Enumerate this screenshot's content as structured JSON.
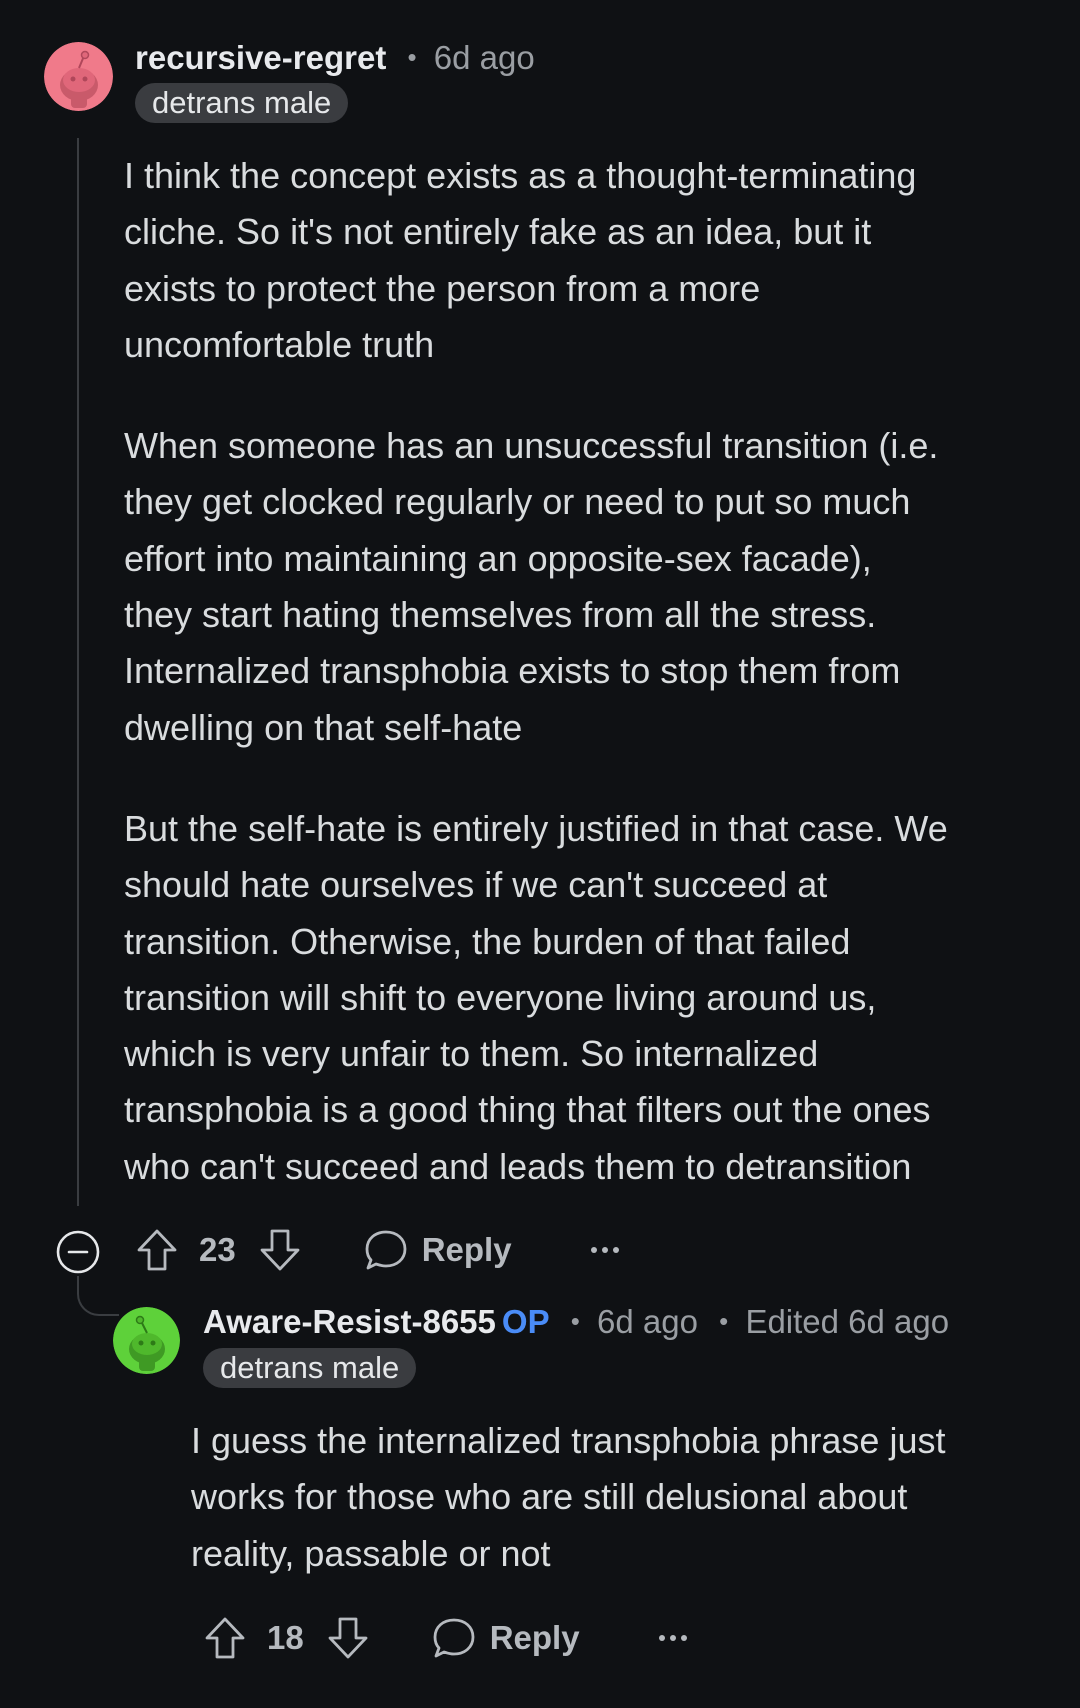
{
  "comments": [
    {
      "username": "recursive-regret",
      "separator": "•",
      "timestamp": "6d ago",
      "flair": "detrans male",
      "paragraphs": [
        [
          "I think the concept exists as a thought-terminating",
          "cliche. So it's not entirely fake as an idea, but it",
          "exists to protect the person from a more",
          "uncomfortable truth"
        ],
        [
          "When someone has an unsuccessful transition (i.e.",
          "they get clocked regularly or need to put so much",
          "effort into maintaining an opposite-sex facade),",
          "they start hating themselves from all the stress.",
          "Internalized transphobia exists to stop them from",
          "dwelling on that self-hate"
        ],
        [
          "But the self-hate is entirely justified in that case. We",
          "should hate ourselves if we can't succeed at",
          "transition. Otherwise, the burden of that failed",
          "transition will shift to everyone living around us,",
          "which is very unfair to them. So internalized",
          "transphobia is a good thing that filters out the ones",
          "who can't succeed and leads them to detransition"
        ]
      ],
      "votes": "23",
      "reply_label": "Reply",
      "avatar_color": "#f07a8a"
    },
    {
      "username": "Aware-Resist-8655",
      "op_badge": "OP",
      "separator": "•",
      "timestamp": "6d ago",
      "edited": "Edited 6d ago",
      "flair": "detrans male",
      "paragraphs": [
        [
          "I guess the internalized transphobia phrase just",
          "works for those who are still delusional about",
          "reality, passable or not"
        ]
      ],
      "votes": "18",
      "reply_label": "Reply",
      "avatar_color": "#5ed13a"
    }
  ],
  "icons": {
    "upvote": "arrow-up-outline",
    "downvote": "arrow-down-outline",
    "reply": "speech-bubble-outline",
    "more": "ellipsis",
    "collapse": "circle-minus"
  },
  "colors": {
    "background": "#0f1114",
    "op_badge": "#4a8cf7",
    "flair_bg": "#3a3c40"
  }
}
